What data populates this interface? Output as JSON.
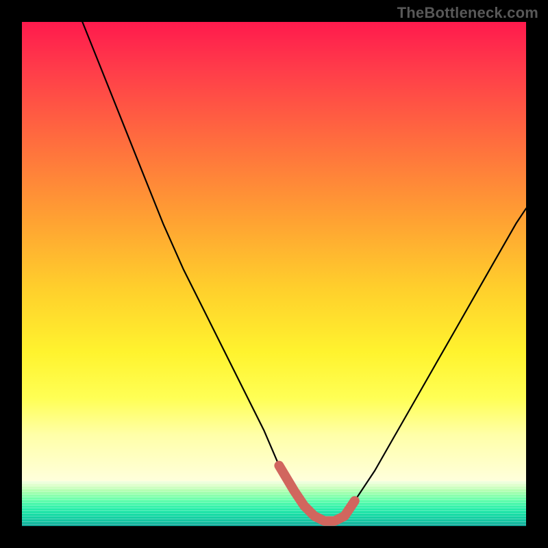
{
  "watermark": "TheBottleneck.com",
  "chart_data": {
    "type": "line",
    "title": "",
    "xlabel": "",
    "ylabel": "",
    "xlim": [
      0,
      100
    ],
    "ylim": [
      0,
      100
    ],
    "grid": false,
    "series": [
      {
        "name": "bottleneck-curve",
        "x": [
          12,
          16,
          20,
          24,
          28,
          32,
          36,
          40,
          44,
          48,
          51,
          54,
          56,
          58,
          60,
          62,
          64,
          66,
          70,
          74,
          78,
          82,
          86,
          90,
          94,
          98,
          100
        ],
        "y": [
          100,
          90,
          80,
          70,
          60,
          51,
          43,
          35,
          27,
          19,
          12,
          7,
          4,
          2,
          1,
          1,
          2,
          5,
          11,
          18,
          25,
          32,
          39,
          46,
          53,
          60,
          63
        ]
      }
    ],
    "highlight": {
      "name": "optimal-range",
      "x": [
        51,
        54,
        56,
        58,
        60,
        62,
        64,
        66
      ],
      "y": [
        12,
        7,
        4,
        2,
        1,
        1,
        2,
        5
      ],
      "color": "#d1665e"
    },
    "background_gradient": {
      "top": "#ff1a4d",
      "mid": "#fff32e",
      "bottom": "#109f94"
    }
  }
}
